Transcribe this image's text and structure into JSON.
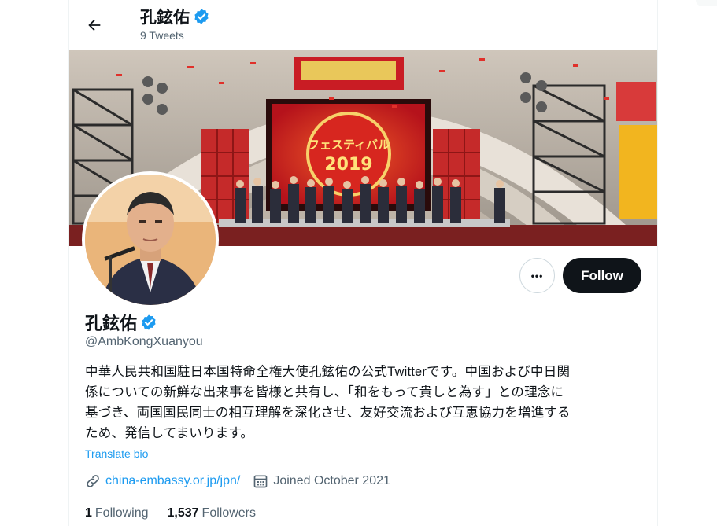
{
  "header": {
    "name": "孔鉉佑",
    "tweet_count": "9 Tweets"
  },
  "banner": {
    "sign_text": "フェスティバル 2019",
    "icon": "event-stage-banner-image"
  },
  "avatar": {
    "icon": "profile-photo"
  },
  "actions": {
    "more_label": "•••",
    "follow_label": "Follow"
  },
  "profile": {
    "name": "孔鉉佑",
    "handle": "@AmbKongXuanyou",
    "bio_lines": [
      "中華人民共和国駐日本国特命全権大使孔鉉佑の公式Twitterです。中国および中日関",
      "係についての新鮮な出来事を皆様と共有し、「和をもって貴しと為す」との理念に",
      "基づき、両国国民同士の相互理解を深化させ、友好交流および互恵協力を増進する",
      "ため、発信してまいります。"
    ],
    "translate_label": "Translate bio",
    "website": "china-embassy.or.jp/jpn/",
    "joined": "Joined October 2021",
    "following_count": "1",
    "following_label": "Following",
    "followers_count": "1,537",
    "followers_label": "Followers"
  },
  "colors": {
    "accent": "#1d9bf0",
    "verified": "#1d9bf0",
    "text_primary": "#0f1419",
    "text_secondary": "#536471"
  }
}
